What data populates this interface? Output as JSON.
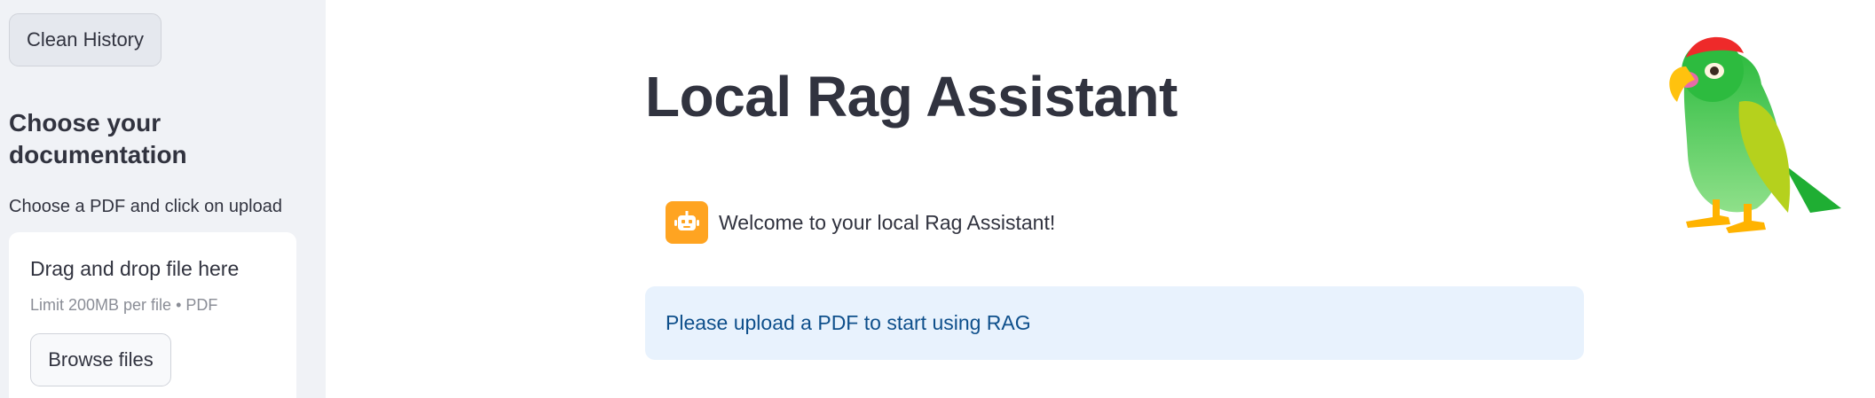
{
  "sidebar": {
    "clean_history_label": "Clean History",
    "heading": "Choose your documentation",
    "caption": "Choose a PDF and click on upload",
    "uploader": {
      "title": "Drag and drop file here",
      "limit": "Limit 200MB per file • PDF",
      "browse_label": "Browse files"
    }
  },
  "main": {
    "title": "Local Rag Assistant",
    "chat": {
      "assistant_avatar_icon": "robot-icon",
      "message": "Welcome to your local Rag Assistant!"
    },
    "info": {
      "text": "Please upload a PDF to start using RAG"
    },
    "logo_icon": "parrot-icon"
  },
  "colors": {
    "sidebar_bg": "#f0f2f6",
    "avatar_bg": "#ffa421",
    "info_bg": "#e8f2fd",
    "info_text": "#0e4f8b",
    "text": "#31333f"
  }
}
